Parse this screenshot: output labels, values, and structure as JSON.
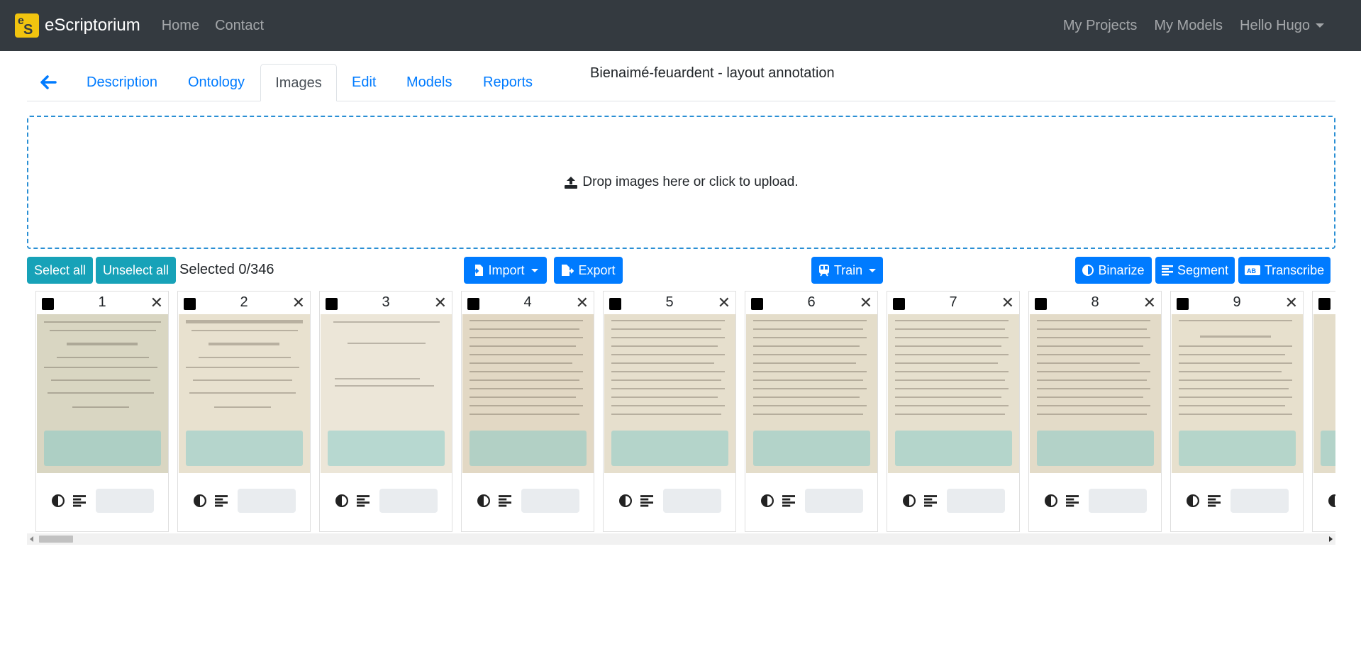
{
  "navbar": {
    "brand": "eScriptorium",
    "links": [
      "Home",
      "Contact"
    ],
    "right_links": [
      "My Projects",
      "My Models"
    ],
    "user_menu": "Hello Hugo"
  },
  "tabs": {
    "items": [
      "Description",
      "Ontology",
      "Images",
      "Edit",
      "Models",
      "Reports"
    ],
    "active": "Images"
  },
  "document_title": "Bienaimé-feuardent - layout annotation",
  "dropzone": {
    "text": "Drop images here or click to upload."
  },
  "toolbar": {
    "select_all": "Select all",
    "unselect_all": "Unselect all",
    "selected": "Selected 0/346",
    "import": "Import",
    "export": "Export",
    "train": "Train",
    "binarize": "Binarize",
    "segment": "Segment",
    "transcribe": "Transcribe"
  },
  "cards": [
    {
      "number": "1"
    },
    {
      "number": "2"
    },
    {
      "number": "3"
    },
    {
      "number": "4"
    },
    {
      "number": "5"
    },
    {
      "number": "6"
    },
    {
      "number": "7"
    },
    {
      "number": "8"
    },
    {
      "number": "9"
    },
    {
      "number": ""
    }
  ],
  "colors": {
    "navbar": "#343a40",
    "primary": "#007bff",
    "teal": "#17a2b8",
    "logo": "#f1c40f"
  }
}
